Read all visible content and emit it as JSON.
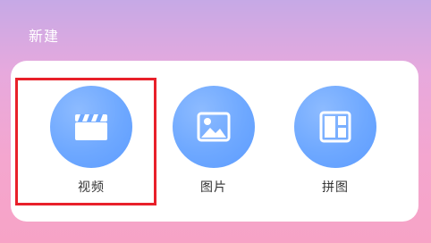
{
  "header": {
    "title": "新建"
  },
  "options": {
    "video": {
      "label": "视频",
      "icon": "video-clapperboard-icon"
    },
    "image": {
      "label": "图片",
      "icon": "image-icon"
    },
    "collage": {
      "label": "拼图",
      "icon": "collage-layout-icon"
    }
  },
  "colors": {
    "icon_circle": "#6ea8ff",
    "selection_border": "#e8202a",
    "panel_background": "#ffffff"
  }
}
